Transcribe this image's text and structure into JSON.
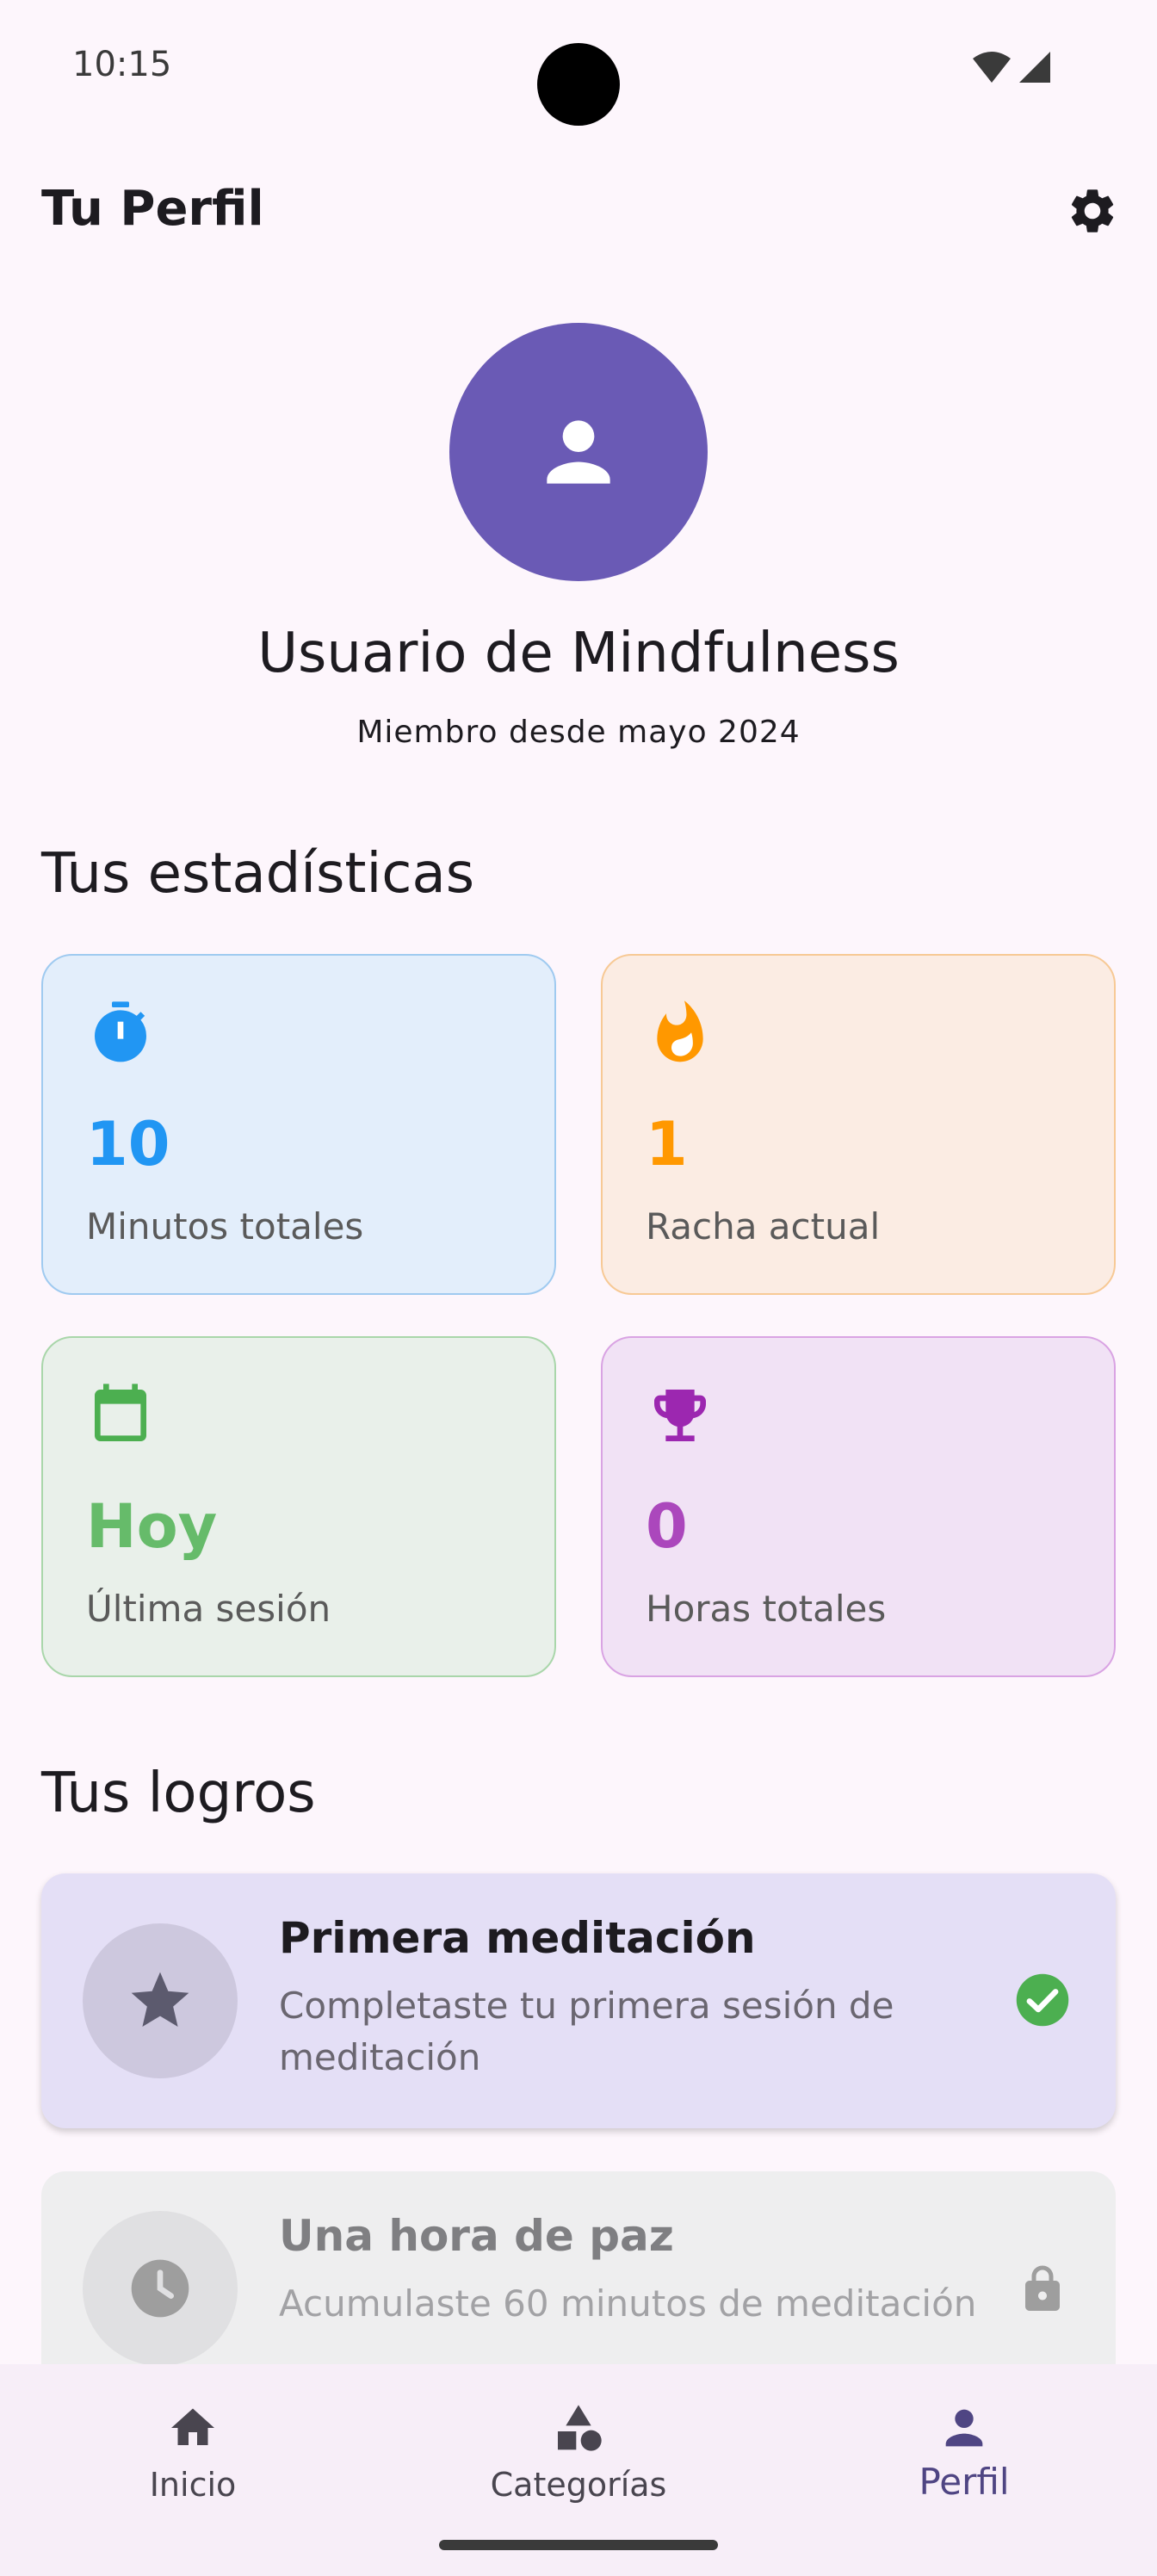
{
  "status_bar": {
    "time": "10:15"
  },
  "app_bar": {
    "title": "Tu Perfil",
    "settings_icon": "gear-icon"
  },
  "profile": {
    "avatar_icon": "person-icon",
    "name": "Usuario de Mindfulness",
    "member_since": "Miembro desde mayo 2024"
  },
  "stats": {
    "title": "Tus estadísticas",
    "cards": [
      {
        "icon": "timer-icon",
        "value": "10",
        "label": "Minutos totales",
        "color": "#2196f3",
        "bg": "#e3eefb",
        "border": "#9fcaf0"
      },
      {
        "icon": "fire-icon",
        "value": "1",
        "label": "Racha actual",
        "color": "#ff9800",
        "bg": "#fbece3",
        "border": "#f7c995"
      },
      {
        "icon": "calendar-icon",
        "value": "Hoy",
        "label": "Última sesión",
        "color": "#4caf50",
        "bg": "#e9f0ea",
        "border": "#a9d6aa"
      },
      {
        "icon": "trophy-icon",
        "value": "0",
        "label": "Horas totales",
        "color": "#9c27b0",
        "bg": "#f1e2f5",
        "border": "#d9a3e3"
      }
    ]
  },
  "achievements": {
    "title": "Tus logros",
    "items": [
      {
        "icon": "star-icon",
        "title": "Primera meditación",
        "description": "Completaste tu primera sesión de meditación",
        "status_icon": "check-circle-icon",
        "unlocked": true
      },
      {
        "icon": "clock-icon",
        "title": "Una hora de paz",
        "description": "Acumulaste 60 minutos de meditación",
        "status_icon": "lock-icon",
        "unlocked": false
      }
    ]
  },
  "bottom_nav": {
    "items": [
      {
        "icon": "home-icon",
        "label": "Inicio",
        "active": false
      },
      {
        "icon": "category-shapes-icon",
        "label": "Categorías",
        "active": false
      },
      {
        "icon": "person-icon",
        "label": "Perfil",
        "active": true
      }
    ],
    "active_color": "#4f4583"
  }
}
